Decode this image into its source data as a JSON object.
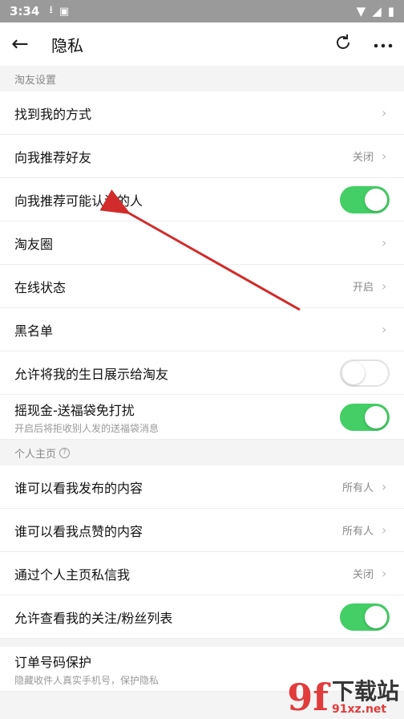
{
  "status_bar": {
    "time": "3:34",
    "icons": [
      "download-icon",
      "a-icon"
    ],
    "right_icons": [
      "wifi-icon",
      "signal-icon",
      "battery-icon"
    ]
  },
  "header": {
    "title": "隐私",
    "back_icon": "back-arrow-icon",
    "refresh_icon": "refresh-icon",
    "more_icon": "more-icon"
  },
  "sections": {
    "friend_settings": "淘友设置",
    "profile": "个人主页"
  },
  "rows": {
    "find_me": {
      "label": "找到我的方式"
    },
    "recommend_friends": {
      "label": "向我推荐好友",
      "value": "关闭"
    },
    "recommend_known": {
      "label": "向我推荐可能认识的人",
      "toggle": "on"
    },
    "friend_circle": {
      "label": "淘友圈"
    },
    "online_status": {
      "label": "在线状态",
      "value": "开启"
    },
    "blacklist": {
      "label": "黑名单"
    },
    "birthday": {
      "label": "允许将我的生日展示给淘友",
      "toggle": "off"
    },
    "lucky_bag": {
      "label": "摇现金-送福袋免打扰",
      "sub": "开启后将拒收别人发的送福袋消息",
      "toggle": "on"
    },
    "who_view_posts": {
      "label": "谁可以看我发布的内容",
      "value": "所有人"
    },
    "who_view_likes": {
      "label": "谁可以看我点赞的内容",
      "value": "所有人"
    },
    "private_message": {
      "label": "通过个人主页私信我",
      "value": "关闭"
    },
    "follow_list": {
      "label": "允许查看我的关注/粉丝列表",
      "toggle": "on"
    },
    "order_phone": {
      "label": "订单号码保护",
      "sub": "隐藏收件人真实手机号，保护隐私"
    }
  },
  "watermark": {
    "logo": "9f",
    "main": "下载站",
    "url": "91xz.net"
  },
  "colors": {
    "toggle_on": "#44cf66",
    "annotation_arrow": "#d22b2b"
  }
}
